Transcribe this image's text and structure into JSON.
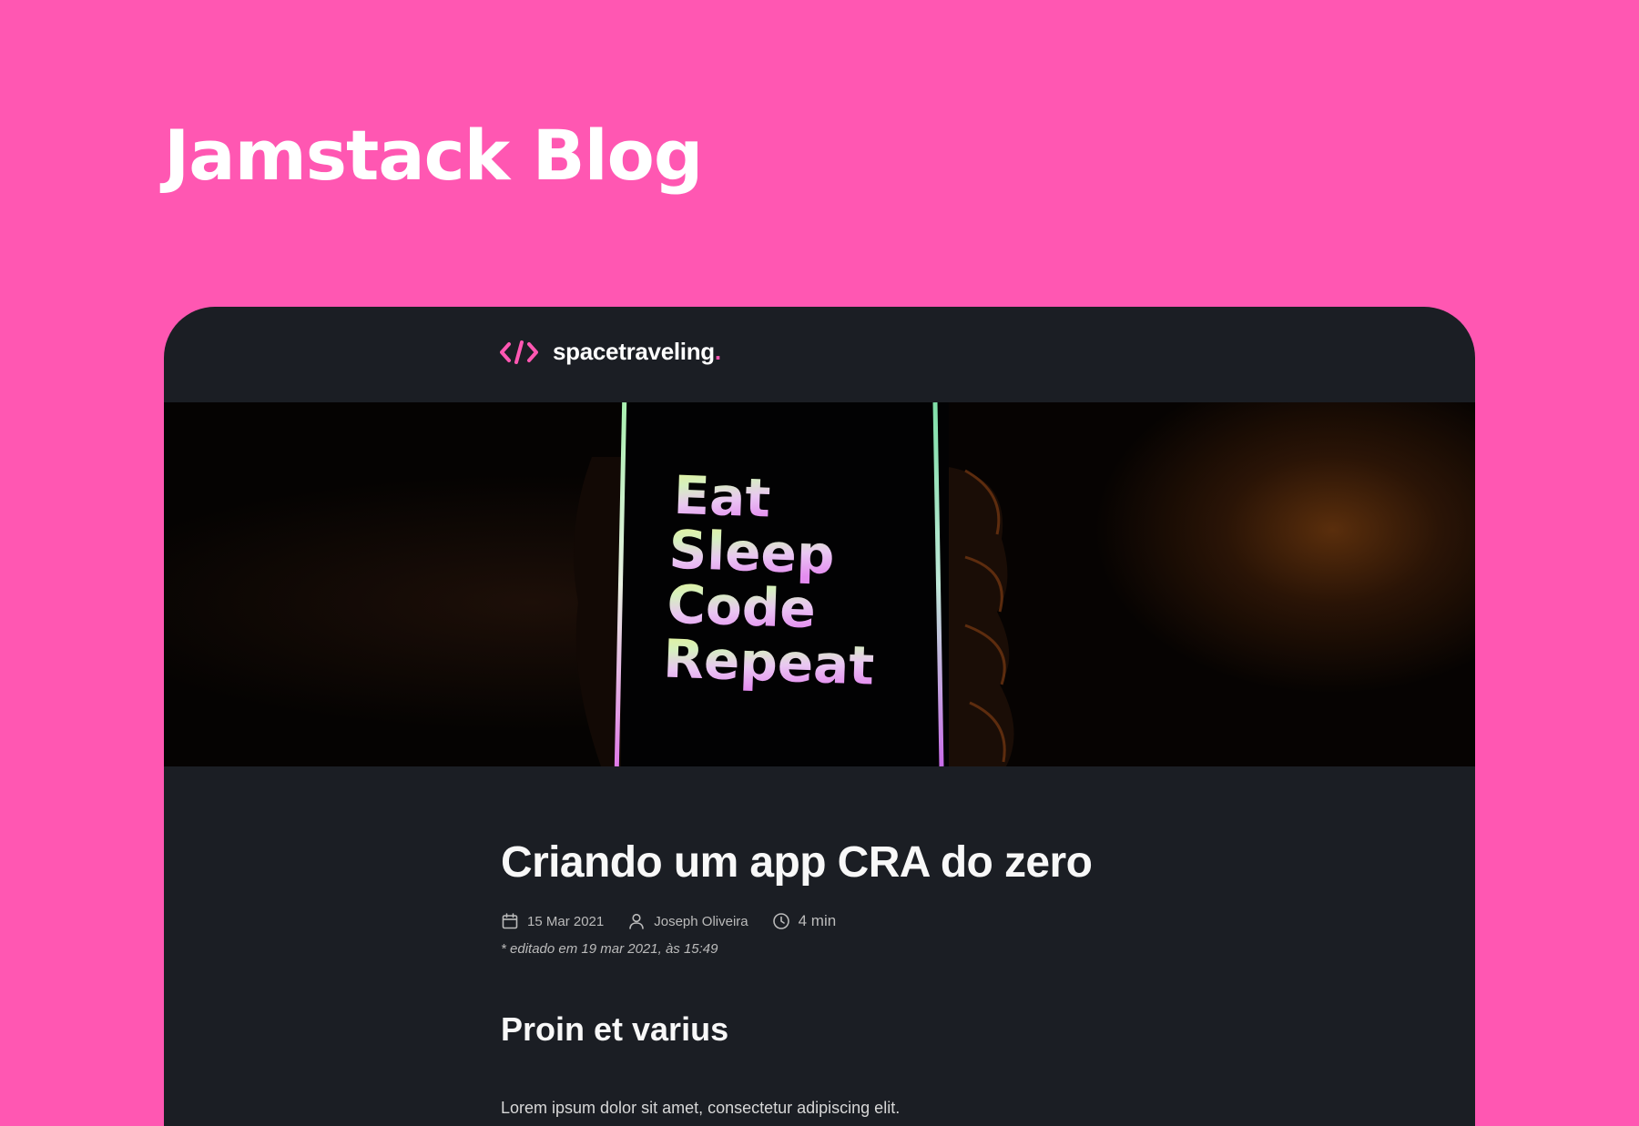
{
  "page": {
    "heading": "Jamstack Blog"
  },
  "header": {
    "logo_text": "spacetraveling",
    "logo_dot": ".",
    "logo_icon": "code-brackets-icon"
  },
  "banner": {
    "image_text_lines": [
      "Eat",
      "Sleep",
      "Code",
      "Repeat"
    ]
  },
  "post": {
    "title": "Criando um app CRA do zero",
    "date": "15 Mar 2021",
    "author": "Joseph Oliveira",
    "reading_time": "4 min",
    "edited_note": "* editado em 19 mar 2021, às 15:49",
    "section_heading": "Proin et varius",
    "paragraph": "Lorem ipsum dolor sit amet, consectetur adipiscing elit."
  },
  "colors": {
    "page_background": "#ff57b2",
    "window_background": "#1b1e24",
    "accent": "#ff57b2",
    "heading_text": "#f8f8f8",
    "muted_text": "#bbbbbb"
  }
}
